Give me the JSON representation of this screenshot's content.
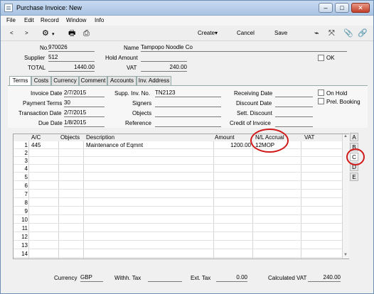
{
  "window": {
    "title": "Purchase Invoice: New",
    "controls": [
      "–",
      "□",
      "✕"
    ]
  },
  "menu": [
    "File",
    "Edit",
    "Record",
    "Window",
    "Info"
  ],
  "toolbar": {
    "nav_prev": "<",
    "nav_next": ">",
    "create": "Create▾",
    "cancel": "Cancel",
    "save": "Save"
  },
  "header": {
    "no_label": "No.",
    "no_value": "970026",
    "name_label": "Name",
    "name_value": "Tampopo Noodle Co",
    "supplier_label": "Supplier",
    "supplier_value": "512",
    "hold_amount_label": "Hold Amount",
    "hold_amount_value": "",
    "ok_label": "OK",
    "total_label": "TOTAL",
    "total_value": "1440.00",
    "vat_label": "VAT",
    "vat_value": "240.00"
  },
  "tabs": [
    "Terms",
    "Costs",
    "Currency",
    "Comment",
    "Accounts",
    "Inv. Address"
  ],
  "terms": {
    "invoice_date_label": "Invoice Date",
    "invoice_date_value": "2/7/2015",
    "payment_terms_label": "Payment Terms",
    "payment_terms_value": "30",
    "transaction_date_label": "Transaction Date",
    "transaction_date_value": "2/7/2015",
    "due_date_label": "Due Date",
    "due_date_value": "1/8/2015",
    "supp_inv_no_label": "Supp. Inv. No.",
    "supp_inv_no_value": "TN2123",
    "signers_label": "Signers",
    "signers_value": "",
    "objects_label": "Objects",
    "objects_value": "",
    "reference_label": "Reference",
    "reference_value": "",
    "receiving_date_label": "Receiving Date",
    "receiving_date_value": "",
    "discount_date_label": "Discount Date",
    "discount_date_value": "",
    "sett_discount_label": "Sett. Discount",
    "sett_discount_value": "",
    "credit_of_invoice_label": "Credit of Invoice",
    "credit_of_invoice_value": "",
    "on_hold_label": "On Hold",
    "prel_booking_label": "Prel. Booking"
  },
  "grid": {
    "columns": [
      "A/C",
      "Objects",
      "Description",
      "Amount",
      "N/L Accrual",
      "VAT"
    ],
    "rows": [
      {
        "num": "1",
        "ac": "445",
        "objects": "",
        "description": "Maintenance of Eqmnt",
        "amount": "1200.00",
        "accrual": "12MOP",
        "vat": ""
      },
      {
        "num": "2"
      },
      {
        "num": "3"
      },
      {
        "num": "4"
      },
      {
        "num": "5"
      },
      {
        "num": "6"
      },
      {
        "num": "7"
      },
      {
        "num": "8"
      },
      {
        "num": "9"
      },
      {
        "num": "10"
      },
      {
        "num": "11"
      },
      {
        "num": "12"
      },
      {
        "num": "13"
      },
      {
        "num": "14"
      }
    ],
    "side_tabs": [
      "A",
      "B",
      "C",
      "D",
      "E"
    ]
  },
  "footer": {
    "currency_label": "Currency",
    "currency_value": "GBP",
    "withh_tax_label": "Withh. Tax",
    "withh_tax_value": "",
    "ext_tax_label": "Ext. Tax",
    "ext_tax_value": "0.00",
    "calc_vat_label": "Calculated VAT",
    "calc_vat_value": "240.00"
  }
}
